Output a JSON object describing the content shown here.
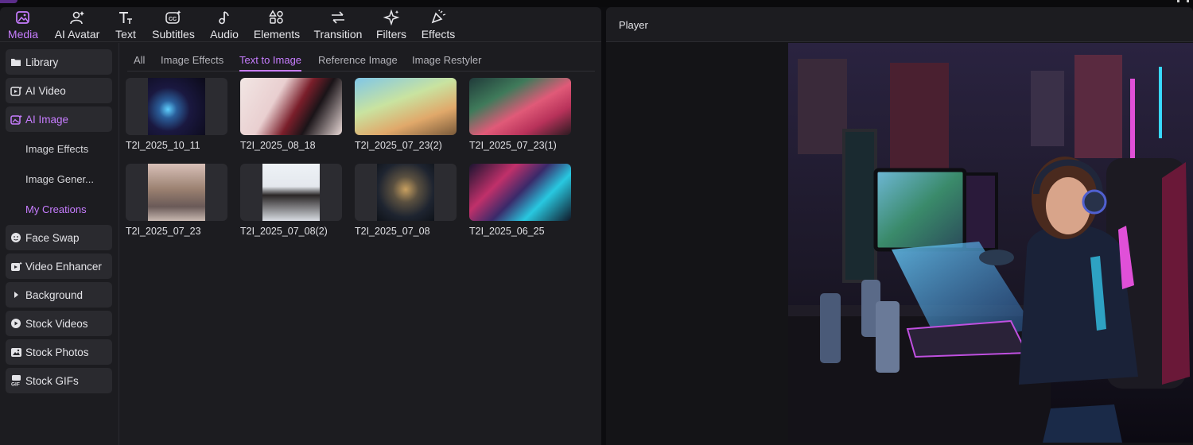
{
  "toolbar": {
    "items": [
      {
        "label": "Media",
        "icon": "media-icon",
        "active": true
      },
      {
        "label": "AI Avatar",
        "icon": "ai-avatar-icon"
      },
      {
        "label": "Text",
        "icon": "text-icon"
      },
      {
        "label": "Subtitles",
        "icon": "subtitles-icon"
      },
      {
        "label": "Audio",
        "icon": "audio-icon"
      },
      {
        "label": "Elements",
        "icon": "elements-icon"
      },
      {
        "label": "Transition",
        "icon": "transition-icon"
      },
      {
        "label": "Filters",
        "icon": "filters-icon"
      },
      {
        "label": "Effects",
        "icon": "effects-icon"
      }
    ]
  },
  "sidebar": {
    "items": [
      {
        "label": "Library",
        "icon": "folder-icon"
      },
      {
        "label": "AI Video",
        "icon": "ai-video-icon"
      },
      {
        "label": "AI Image",
        "icon": "ai-image-icon",
        "active": true
      },
      {
        "label": "Image Effects"
      },
      {
        "label": "Image Gener..."
      },
      {
        "label": "My Creations",
        "active": true
      },
      {
        "label": "Face Swap",
        "icon": "face-swap-icon"
      },
      {
        "label": "Video Enhancer",
        "icon": "video-enhancer-icon"
      },
      {
        "label": "Background",
        "icon": "caret-right-icon"
      },
      {
        "label": "Stock Videos",
        "icon": "play-circle-icon"
      },
      {
        "label": "Stock Photos",
        "icon": "photo-icon"
      },
      {
        "label": "Stock GIFs",
        "icon": "gif-icon"
      }
    ]
  },
  "tabs": [
    {
      "label": "All"
    },
    {
      "label": "Image Effects"
    },
    {
      "label": "Text to Image",
      "active": true
    },
    {
      "label": "Reference Image"
    },
    {
      "label": "Image Restyler"
    }
  ],
  "thumbnails": [
    {
      "name": "T2I_2025_10_11"
    },
    {
      "name": "T2I_2025_08_18"
    },
    {
      "name": "T2I_2025_07_23(2)"
    },
    {
      "name": "T2I_2025_07_23(1)"
    },
    {
      "name": "T2I_2025_07_23"
    },
    {
      "name": "T2I_2025_07_08(2)"
    },
    {
      "name": "T2I_2025_07_08"
    },
    {
      "name": "T2I_2025_06_25"
    }
  ],
  "player": {
    "title": "Player"
  },
  "colors": {
    "accent": "#c77dff",
    "panel": "#1c1c20",
    "chip": "#2a2a2f"
  }
}
